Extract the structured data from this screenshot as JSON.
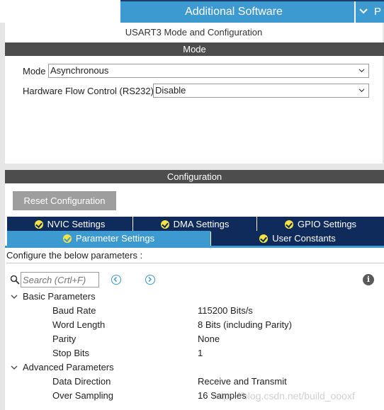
{
  "header": {
    "title": "Additional Software",
    "overflow_label": "P"
  },
  "mode_section": {
    "heading": "USART3 Mode and Configuration",
    "bar_label": "Mode",
    "mode_label": "Mode",
    "mode_value": "Asynchronous",
    "flow_label": "Hardware Flow Control (RS232)",
    "flow_value": "Disable"
  },
  "config_section": {
    "bar_label": "Configuration",
    "reset_label": "Reset Configuration",
    "tabs": [
      {
        "label": "NVIC Settings"
      },
      {
        "label": "DMA Settings"
      },
      {
        "label": "GPIO Settings"
      },
      {
        "label": "Parameter Settings"
      },
      {
        "label": "User Constants"
      }
    ],
    "configure_text": "Configure the below parameters :",
    "search_placeholder": "Search (Crtl+F)"
  },
  "params": {
    "basic_group": "Basic Parameters",
    "advanced_group": "Advanced Parameters",
    "rows": [
      {
        "name": "Baud Rate",
        "value": "115200 Bits/s"
      },
      {
        "name": "Word Length",
        "value": "8 Bits (including Parity)"
      },
      {
        "name": "Parity",
        "value": "None"
      },
      {
        "name": "Stop Bits",
        "value": "1"
      },
      {
        "name": "Data Direction",
        "value": "Receive and Transmit"
      },
      {
        "name": "Over Sampling",
        "value": "16 Samples"
      }
    ]
  },
  "watermark": "https://blog.csdn.net/build_oooxf",
  "colors": {
    "accent": "#3c9ad0",
    "tab_dark": "#0f2b5c",
    "section_bar": "#4d4d4d",
    "check": "#f4e341"
  }
}
